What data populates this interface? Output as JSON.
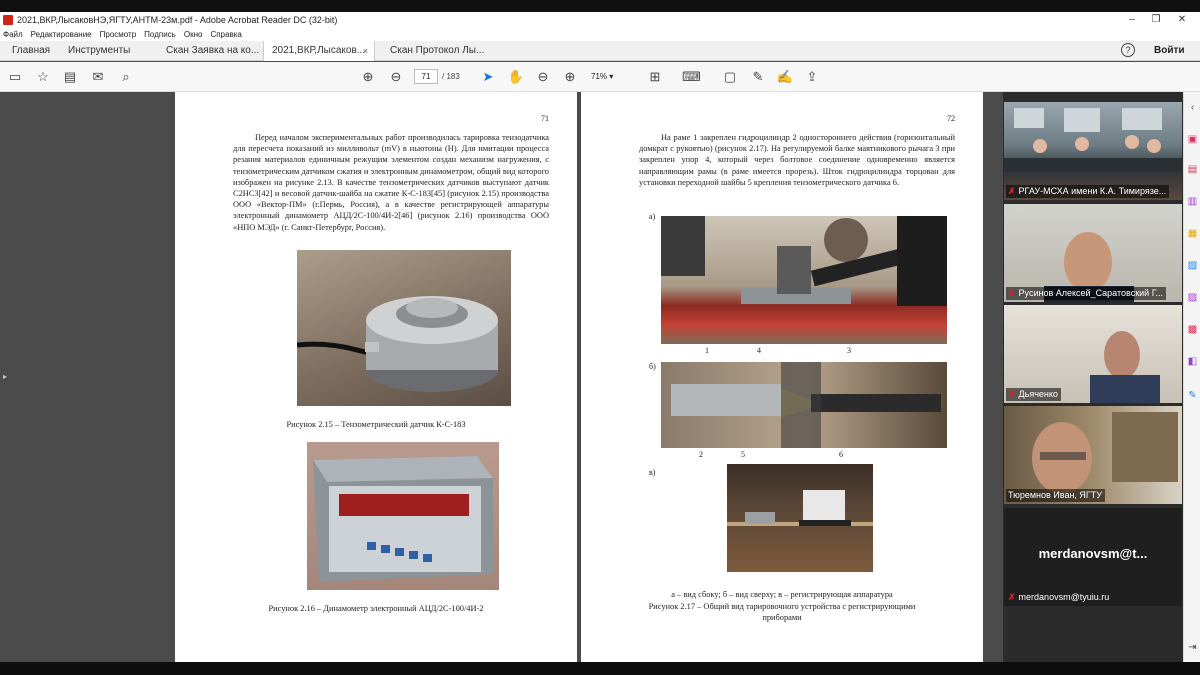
{
  "window": {
    "title": "2021,ВКР,ЛысаковНЭ,ЯГТУ,АНТМ-23м.pdf - Adobe Acrobat Reader DC (32-bit)"
  },
  "menu": [
    "Файл",
    "Редактирование",
    "Просмотр",
    "Подпись",
    "Окно",
    "Справка"
  ],
  "tabs": {
    "home": "Главная",
    "tools": "Инструменты",
    "doc1": "Скан Заявка на ко...",
    "doc2": "2021,ВКР,Лысаков...",
    "doc3": "Скан Протокол Лы...",
    "close": "×"
  },
  "signin": "Войти",
  "help": "?",
  "toolbar": {
    "page_current": "71",
    "page_total": "/ 183",
    "zoom": "71%"
  },
  "page71": {
    "number": "71",
    "para": "Перед началом экспериментальных работ производилась тарировка тензодатчика для пересчета показаний из милливольт (mV) в ньютоны (Н). Для имитации процесса резания материалов единичным режущим элементом создан механизм нагружения, с тензометрическим датчиком сжатия и электронным динамометром, общий вид которого изображен на рисунке 2.13. В качестве тензометрических датчиков выступают датчик С2НС3[42] и весовой датчик-шайба на сжатие К-С-183[45] (рисунок 2.15) производства ООО «Вектор-ПМ» (г.Пермь, Россия), а в качестве регистрирующей аппаратуры электронный динамометр АЦД/2С-100/4И-2[46] (рисунок 2.16) производства ООО «НПО МЭД» (г. Санкт-Петербург, Россия).",
    "caption1": "Рисунок 2.15 – Тензометрический датчик К-С-183",
    "caption2": "Рисунок 2.16 – Динамометр электронный АЦД/2С-100/4И-2"
  },
  "page72": {
    "number": "72",
    "para": "На раме 1 закреплен гидроцилиндр 2 одностороннего действия (горизонтальный домкрат с рукоятью) (рисунок 2.17). На регулируемой балке маятникового рычага 3 при закреплен упор 4, который через болтовое соединение одновременно является направляющим рамы (в раме имеется прорезь). Шток гидроцилиндра торцован для установки переходной шайбы 5 крепления тензометрического датчика 6.",
    "label_a": "а)",
    "label_b": "б)",
    "label_c": "в)",
    "callouts_a": [
      "1",
      "4",
      "3"
    ],
    "callouts_b": [
      "2",
      "5",
      "6"
    ],
    "caption_sub": "а – вид сбоку; б – вид сверху; в – регистрирующая аппаратура",
    "caption": "Рисунок 2.17 – Общий вид тарировочного устройства с регистрирующими приборами"
  },
  "gallery": [
    {
      "name": "РГАУ-МСХА имени К.А. Тимирязе..."
    },
    {
      "name": "Русинов Алексей_Саратовский Г..."
    },
    {
      "name": "Дьяченко"
    },
    {
      "name": "Тюремнов Иван, ЯГТУ"
    },
    {
      "name": "merdanovsm@tyuiu.ru",
      "large": "merdanovsm@t..."
    }
  ],
  "colors": {
    "accent": "#1473e6",
    "mic_off": "#e02020",
    "toolbar_bg": "#f7f7f7"
  }
}
